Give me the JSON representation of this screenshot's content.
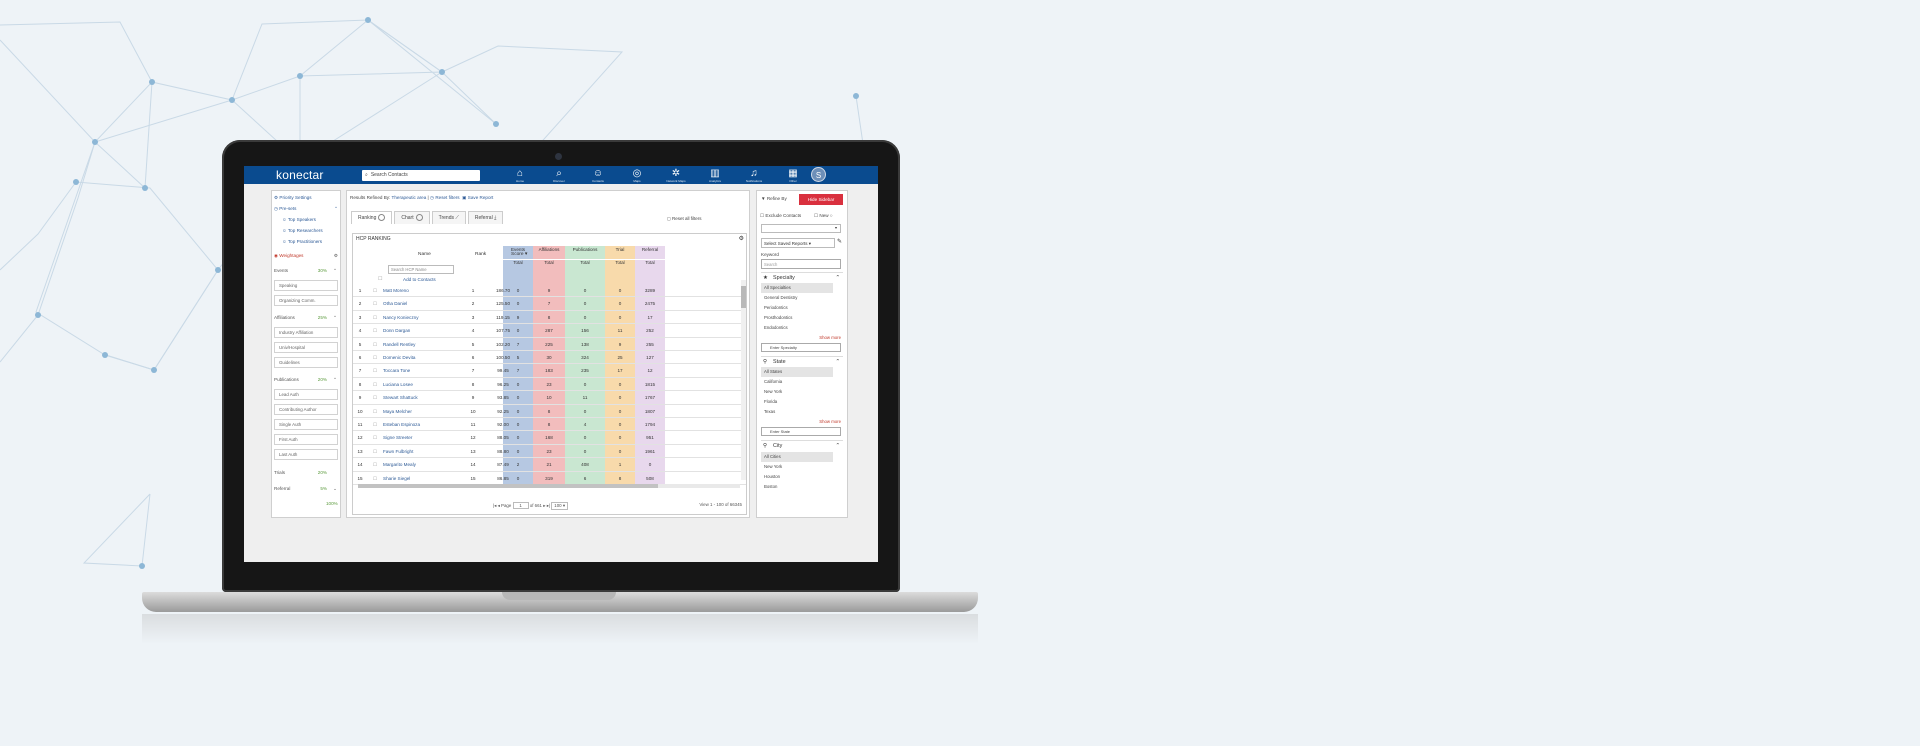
{
  "app": {
    "logo": "konectar",
    "search_placeholder": "Search Contacts",
    "avatar_letter": "S",
    "nav": [
      {
        "icon": "home-icon",
        "glyph": "⌂",
        "label": "Home"
      },
      {
        "icon": "discover-icon",
        "glyph": "⌕",
        "label": "Discover"
      },
      {
        "icon": "contacts-icon",
        "glyph": "☺",
        "label": "Contacts"
      },
      {
        "icon": "maps-icon",
        "glyph": "◎",
        "label": "Maps"
      },
      {
        "icon": "network-icon",
        "glyph": "✲",
        "label": "Network Maps"
      },
      {
        "icon": "analytics-icon",
        "glyph": "▥",
        "label": "Analytics"
      },
      {
        "icon": "bell-icon",
        "glyph": "♫",
        "label": "Notifications"
      },
      {
        "icon": "grid-icon",
        "glyph": "▦",
        "label": "Other"
      }
    ]
  },
  "left_panel": {
    "priority_settings": "Priority Settings",
    "presets": "Pre-sets",
    "preset_items": [
      "Top Speakers",
      "Top Researchers",
      "Top Practitioners"
    ],
    "weightages": "Weightages",
    "sections": [
      {
        "label": "Events",
        "pct": "30%",
        "subs": [
          "Speaking",
          "Organizing Comm."
        ]
      },
      {
        "label": "Affiliations",
        "pct": "25%",
        "subs": [
          "Industry Affiliation",
          "Univ/Hospital",
          "Guidelines"
        ]
      },
      {
        "label": "Publications",
        "pct": "20%",
        "subs": [
          "Lead Auth",
          "Contributing Author",
          "Single Auth",
          "First Auth",
          "Last Auth"
        ]
      },
      {
        "label": "Trials",
        "pct": "20%",
        "subs": []
      },
      {
        "label": "Referral",
        "pct": "5%",
        "subs": []
      }
    ],
    "total": "100%"
  },
  "main": {
    "refined_by_label": "Results Refined By:",
    "refined_by_value": "Therapeutic area",
    "reset_filters": "Reset filters",
    "save_report": "Save Report",
    "tabs": [
      "Ranking",
      "Chart",
      "Trends",
      "Referral"
    ],
    "reset_all": "Reset all filters",
    "table_title": "HCP RANKING",
    "col_name": "Name",
    "col_rank": "Rank",
    "col_score": "Score",
    "search_placeholder": "Search HCP Name",
    "add_to_contacts": "Add to Contacts",
    "groups": [
      {
        "label": "Events",
        "color": "#a9bedd",
        "sub": "Total"
      },
      {
        "label": "Affiliations",
        "color": "#f0b2b2",
        "sub": "Total"
      },
      {
        "label": "Publications",
        "color": "#bfe3c9",
        "sub": "Total"
      },
      {
        "label": "Trial",
        "color": "#f7d39c",
        "sub": "Total"
      },
      {
        "label": "Referral",
        "color": "#e4d1ea",
        "sub": "Total"
      }
    ],
    "rows": [
      [
        "1",
        "Matt Moreno",
        "1",
        "186.70",
        "0",
        "9",
        "0",
        "0",
        "3289"
      ],
      [
        "2",
        "Otha Daniel",
        "2",
        "125.50",
        "0",
        "7",
        "0",
        "0",
        "2475"
      ],
      [
        "3",
        "Nancy Konieczny",
        "3",
        "119.15",
        "9",
        "8",
        "0",
        "0",
        "17"
      ],
      [
        "4",
        "Donn Dargan",
        "4",
        "107.75",
        "0",
        "287",
        "156",
        "11",
        "252"
      ],
      [
        "5",
        "Randell Rentley",
        "5",
        "102.20",
        "7",
        "225",
        "138",
        "9",
        "255"
      ],
      [
        "6",
        "Domenic Devita",
        "6",
        "100.50",
        "5",
        "30",
        "324",
        "25",
        "127"
      ],
      [
        "7",
        "Toccara Tone",
        "7",
        "99.45",
        "7",
        "183",
        "235",
        "17",
        "12"
      ],
      [
        "8",
        "Luciana Losee",
        "8",
        "96.25",
        "0",
        "23",
        "0",
        "0",
        "1815"
      ],
      [
        "9",
        "Stewart Shattuck",
        "9",
        "93.85",
        "0",
        "10",
        "11",
        "0",
        "1767"
      ],
      [
        "10",
        "Maya Melcher",
        "10",
        "92.25",
        "0",
        "8",
        "0",
        "0",
        "1807"
      ],
      [
        "11",
        "Esteban Espinoza",
        "11",
        "92.00",
        "0",
        "8",
        "4",
        "0",
        "1794"
      ],
      [
        "12",
        "Signe Streeter",
        "12",
        "88.05",
        "0",
        "168",
        "0",
        "0",
        "951"
      ],
      [
        "13",
        "Fawn Fulbright",
        "13",
        "88.80",
        "0",
        "23",
        "0",
        "0",
        "1961"
      ],
      [
        "14",
        "Margarito Mealy",
        "14",
        "87.49",
        "2",
        "21",
        "408",
        "1",
        "0"
      ],
      [
        "15",
        "Sharie Siegel",
        "15",
        "86.85",
        "0",
        "319",
        "6",
        "8",
        "508"
      ]
    ],
    "pager_page_label": "Page",
    "pager_page": "1",
    "pager_of": "of 661",
    "pager_size": "100",
    "view_text": "View 1 - 100 of 66345"
  },
  "right_panel": {
    "refine_by": "Refine By",
    "hide_sidebar": "Hide Sidebar",
    "exclude_contacts": "Exclude Contacts",
    "new": "New",
    "saved_reports": "Select Saved Reports",
    "keyword": "Keyword",
    "keyword_placeholder": "Search",
    "specialty": "Specialty",
    "specialty_items": [
      "All Specialties",
      "General Dentistry",
      "Periodontics",
      "Prosthodontics",
      "Endodontics"
    ],
    "show_more": "Show more",
    "specialty_input": "Enter Specialty",
    "state": "State",
    "state_items": [
      "All States",
      "California",
      "New York",
      "Florida",
      "Texas"
    ],
    "state_input": "Enter State",
    "city": "City",
    "city_items": [
      "All Cities",
      "New York",
      "Houston",
      "Boston"
    ]
  }
}
